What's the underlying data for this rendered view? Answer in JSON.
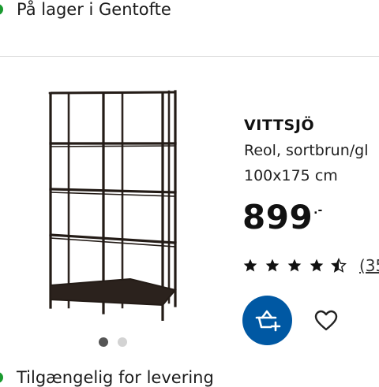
{
  "colors": {
    "in_stock": "#1a9a2f",
    "brand_blue": "#0058a3",
    "text": "#111111"
  },
  "availability": {
    "store_status": "På lager i Gentofte",
    "delivery_status": "Tilgængelig for levering"
  },
  "product": {
    "name": "VITTSJÖ",
    "description": "Reol, sortbrun/gl",
    "size": "100x175 cm",
    "price": "899",
    "price_suffix": ".-",
    "rating": 4.5,
    "review_count_label": "(35"
  },
  "carousel": {
    "count": 2,
    "active_index": 0
  },
  "actions": {
    "cart_icon": "shopping-basket-plus-icon",
    "wishlist_icon": "heart-outline-icon"
  }
}
